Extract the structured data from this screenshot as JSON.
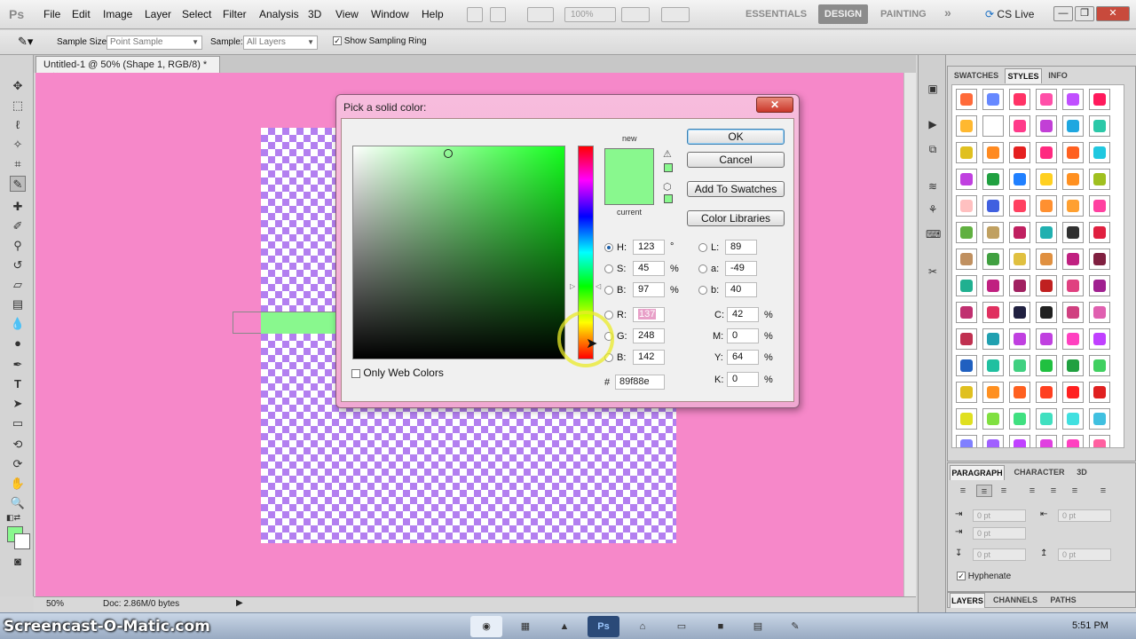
{
  "app": {
    "logo": "Ps",
    "menu": [
      "File",
      "Edit",
      "Image",
      "Layer",
      "Select",
      "Filter",
      "Analysis",
      "3D",
      "View",
      "Window",
      "Help"
    ],
    "zoom_combo": "100%",
    "workspaces": {
      "essentials": "ESSENTIALS",
      "design": "DESIGN",
      "painting": "PAINTING",
      "more": "»"
    },
    "cs_live": "CS Live",
    "window_buttons": [
      "—",
      "❐",
      "✕"
    ]
  },
  "options": {
    "sample_size_label": "Sample Size:",
    "sample_size_value": "Point Sample",
    "sample_label": "Sample:",
    "sample_value": "All Layers",
    "show_ring_label": "Show Sampling Ring",
    "show_ring_checked": true
  },
  "document": {
    "tab_title": "Untitled-1 @ 50% (Shape 1, RGB/8) *",
    "tab_close": "×",
    "canvas_bg": "#f688c9",
    "zoom": "50%",
    "doc_info": "Doc: 2.86M/0 bytes"
  },
  "dialog": {
    "title": "Pick a solid color:",
    "close": "✕",
    "label_new": "new",
    "label_current": "current",
    "new_color": "#89f88e",
    "current_color": "#89f88e",
    "buttons": {
      "ok": "OK",
      "cancel": "Cancel",
      "add": "Add To Swatches",
      "libraries": "Color Libraries"
    },
    "hsb": [
      {
        "label": "H:",
        "value": "123",
        "unit": "°",
        "selected": true
      },
      {
        "label": "S:",
        "value": "45",
        "unit": "%",
        "selected": false
      },
      {
        "label": "B:",
        "value": "97",
        "unit": "%",
        "selected": false
      }
    ],
    "rgb": [
      {
        "label": "R:",
        "value": "137"
      },
      {
        "label": "G:",
        "value": "248"
      },
      {
        "label": "B:",
        "value": "142"
      }
    ],
    "lab": [
      {
        "label": "L:",
        "value": "89"
      },
      {
        "label": "a:",
        "value": "-49"
      },
      {
        "label": "b:",
        "value": "40"
      }
    ],
    "cmyk": [
      {
        "label": "C:",
        "value": "42",
        "unit": "%"
      },
      {
        "label": "M:",
        "value": "0",
        "unit": "%"
      },
      {
        "label": "Y:",
        "value": "64",
        "unit": "%"
      },
      {
        "label": "K:",
        "value": "0",
        "unit": "%"
      }
    ],
    "hash": "#",
    "hex": "89f88e",
    "web_colors_label": "Only Web Colors"
  },
  "panels": {
    "styles_tabs": [
      "SWATCHES",
      "STYLES",
      "INFO"
    ],
    "para_tabs": [
      "PARAGRAPH",
      "CHARACTER",
      "3D"
    ],
    "para_fields": [
      "0 pt",
      "0 pt",
      "0 pt",
      "0 pt",
      "0 pt"
    ],
    "hyphenate_label": "Hyphenate",
    "layers_tabs": [
      "LAYERS",
      "CHANNELS",
      "PATHS"
    ]
  },
  "taskbar": {
    "watermark": "Screencast-O-Matic.com",
    "clock": "5:51 PM"
  }
}
